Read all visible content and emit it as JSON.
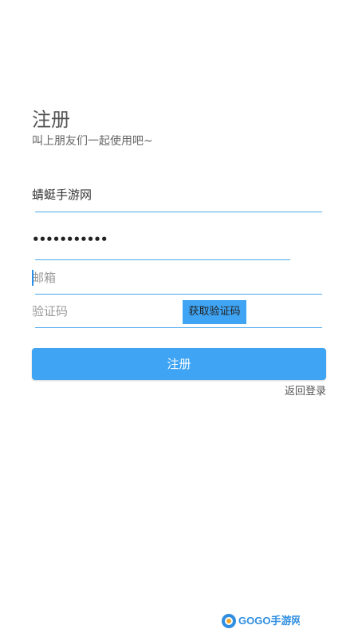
{
  "header": {
    "title": "注册",
    "subtitle": "叫上朋友们一起使用吧~"
  },
  "form": {
    "username_value": "蜻蜓手游网",
    "password_masked": "•••••••••••",
    "email_placeholder": "邮箱",
    "code_placeholder": "验证码",
    "get_code_label": "获取验证码",
    "submit_label": "注册",
    "back_login_label": "返回登录"
  },
  "watermark": {
    "text": "GOGO手游网"
  },
  "colors": {
    "accent": "#3fa4f4",
    "underline": "#4aa8ec"
  }
}
